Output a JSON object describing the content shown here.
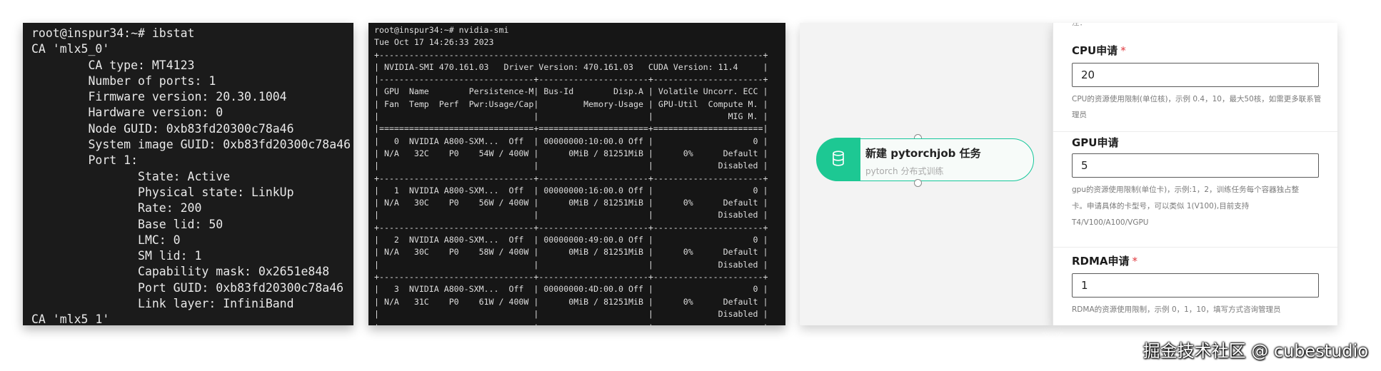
{
  "terminal_ibstat": {
    "lines": [
      "root@inspur34:~# ibstat",
      "CA 'mlx5_0'",
      "        CA type: MT4123",
      "        Number of ports: 1",
      "        Firmware version: 20.30.1004",
      "        Hardware version: 0",
      "        Node GUID: 0xb83fd20300c78a46",
      "        System image GUID: 0xb83fd20300c78a46",
      "        Port 1:",
      "               State: Active",
      "               Physical state: LinkUp",
      "               Rate: 200",
      "               Base lid: 50",
      "               LMC: 0",
      "               SM lid: 1",
      "               Capability mask: 0x2651e848",
      "               Port GUID: 0xb83fd20300c78a46",
      "               Link layer: InfiniBand",
      "CA 'mlx5_1'"
    ]
  },
  "terminal_nvidia_smi": {
    "lines": [
      "root@inspur34:~# nvidia-smi",
      "Tue Oct 17 14:26:33 2023",
      "+-----------------------------------------------------------------------------+",
      "| NVIDIA-SMI 470.161.03   Driver Version: 470.161.03   CUDA Version: 11.4     |",
      "|-------------------------------+----------------------+----------------------+",
      "| GPU  Name        Persistence-M| Bus-Id        Disp.A | Volatile Uncorr. ECC |",
      "| Fan  Temp  Perf  Pwr:Usage/Cap|         Memory-Usage | GPU-Util  Compute M. |",
      "|                               |                      |               MIG M. |",
      "|===============================+======================+======================|",
      "|   0  NVIDIA A800-SXM...  Off  | 00000000:10:00.0 Off |                    0 |",
      "| N/A   32C    P0    54W / 400W |      0MiB / 81251MiB |      0%      Default |",
      "|                               |                      |             Disabled |",
      "+-------------------------------+----------------------+----------------------+",
      "|   1  NVIDIA A800-SXM...  Off  | 00000000:16:00.0 Off |                    0 |",
      "| N/A   30C    P0    56W / 400W |      0MiB / 81251MiB |      0%      Default |",
      "|                               |                      |             Disabled |",
      "+-------------------------------+----------------------+----------------------+",
      "|   2  NVIDIA A800-SXM...  Off  | 00000000:49:00.0 Off |                    0 |",
      "| N/A   30C    P0    58W / 400W |      0MiB / 81251MiB |      0%      Default |",
      "|                               |                      |             Disabled |",
      "+-------------------------------+----------------------+----------------------+",
      "|   3  NVIDIA A800-SXM...  Off  | 00000000:4D:00.0 Off |                    0 |",
      "| N/A   31C    P0    61W / 400W |      0MiB / 81251MiB |      0%      Default |",
      "|                               |                      |             Disabled |",
      "+-------------------------------+----------------------+----------------------+"
    ]
  },
  "pipeline_node": {
    "title": "新建 pytorchjob 任务",
    "subtitle": "pytorch 分布式训练",
    "icon": "database-icon",
    "accent": "#1dc893"
  },
  "form": {
    "top_cut_text": "注：",
    "cpu": {
      "label": "CPU申请",
      "required_mark": "*",
      "value": "20",
      "help": "CPU的资源使用限制(单位核)，示例 0.4，10，最大50核，如需更多联系管理员"
    },
    "gpu": {
      "label": "GPU申请",
      "required_mark": "*",
      "value": "5",
      "help_lines": [
        "gpu的资源使用限制(单位卡)，示例:1，2，训练任务每个容器独占整",
        "卡。申请具体的卡型号，可以类似 1(V100),目前支持",
        "T4/V100/A100/VGPU"
      ]
    },
    "rdma": {
      "label": "RDMA申请",
      "required_mark": "*",
      "value": "1",
      "help": "RDMA的资源使用限制，示例 0，1，10，填写方式咨询管理员"
    }
  },
  "credit": "掘金技术社区 @ cubestudio"
}
